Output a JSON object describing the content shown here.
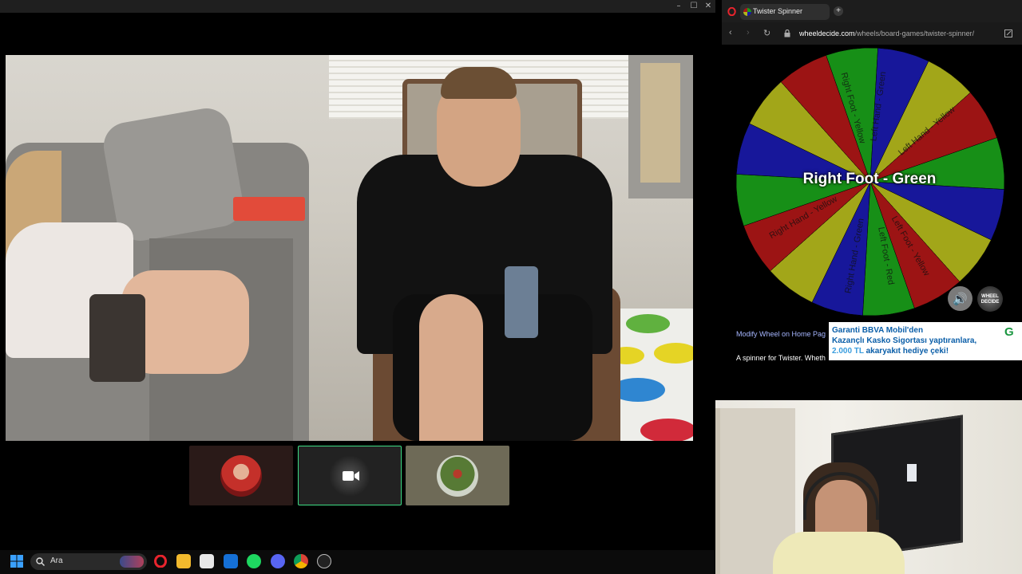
{
  "window": {
    "minimize_glyph": "–",
    "maximize_glyph": "☐",
    "close_glyph": "✕"
  },
  "taskbar": {
    "search_placeholder": "Ara",
    "apps": [
      "windows-start-icon",
      "opera-icon",
      "file-explorer-icon",
      "microsoft-store-icon",
      "outlook-icon",
      "spotify-icon",
      "discord-icon",
      "chrome-icon",
      "obs-icon"
    ]
  },
  "browser": {
    "tab_title": "Twister Spinner",
    "new_tab_glyph": "+",
    "url_domain": "wheeldecide.com",
    "url_path": "/wheels/board-games/twister-spinner/",
    "back_glyph": "‹",
    "forward_glyph": "›",
    "reload_glyph": "↻",
    "lock_glyph": "🔒"
  },
  "wheel": {
    "result": "Right Foot - Green",
    "segment_colors": [
      "#1a9c1a",
      "#1a1aa8",
      "#b0b51c",
      "#aa1616",
      "#1a9c1a",
      "#1a1aa8",
      "#b0b51c",
      "#aa1616",
      "#1a9c1a",
      "#1a1aa8",
      "#b0b51c",
      "#aa1616",
      "#1a9c1a",
      "#1a1aa8",
      "#b0b51c",
      "#aa1616"
    ],
    "visible_labels": [
      "Left Hand - Green",
      "Right Foot - Yellow",
      "Left Hand - Yellow",
      "Right Hand - Yellow",
      "Right Hand - Green",
      "Left Foot - Yellow",
      "Left Foot - Red"
    ],
    "sound_glyph": "🔊",
    "logo_text": "WHEEL DECIDE"
  },
  "page": {
    "modify_link": "Modify Wheel on Home Pag",
    "description": "A spinner for Twister. Wheth"
  },
  "ad": {
    "line1": "Garanti BBVA Mobil'den",
    "line2": "Kazançlı Kasko Sigortası yaptıranlara,",
    "amount": "2.000 TL",
    "line3": " akaryakıt hediye çeki!",
    "logo": "G"
  }
}
